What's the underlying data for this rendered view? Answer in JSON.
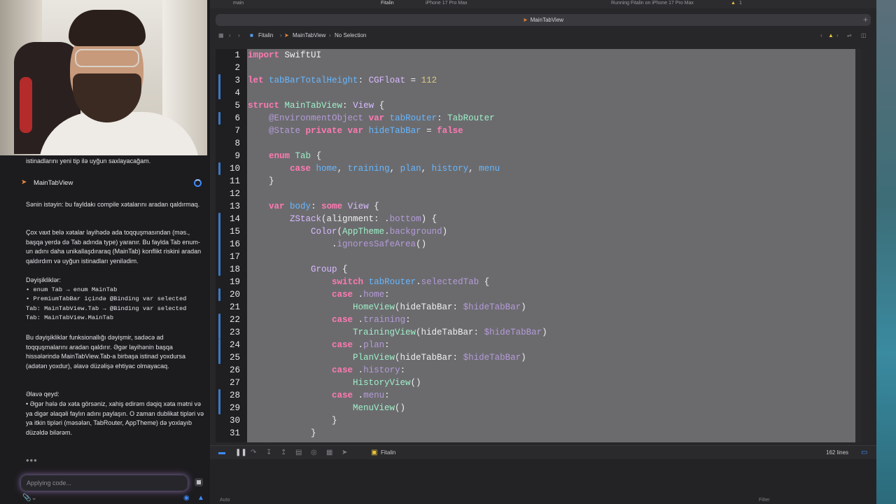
{
  "topbar": {
    "branch": "main",
    "scheme": "Fitalin",
    "device": "iPhone 17 Pro Max",
    "status": "Running Fitalin on iPhone 17 Pro Max",
    "warnings": "1"
  },
  "tab": {
    "file": "MainTabView"
  },
  "jumpbar": {
    "project": "Fitalin",
    "file": "MainTabView",
    "selection": "No Selection"
  },
  "chat": {
    "prev_tail": "istinadlarını yeni tip ilə uyğun saxlayacağam.",
    "file_chip": "MainTabView",
    "para1": "Sənin istəyin: bu fayldakı compile xətalarını aradan qaldırmaq.",
    "para2": "Çox vaxt belə xətalar layihədə ada toqquşmasından (məs., başqa yerdə də Tab adında type) yaranır. Bu faylda Tab enum-un adını daha unikallaşdıraraq (MainTab) konflikt riskini aradan qaldırdım və uyğun istinadları yenilədim.",
    "changes_title": "Dəyişikliklər:",
    "change1": "• enum Tab → enum MainTab",
    "change2": "• PremiumTabBar içində @Binding var selected Tab: MainTabView.Tab → @Binding var selected Tab: MainTabView.MainTab",
    "para3": "Bu dəyişikliklər funksionallığı dəyişmir, sadəcə ad toqquşmalarını aradan qaldırır. Əgər layihənin başqa hissələrində MainTabView.Tab-a birbaşa istinad yoxdursa (adətən yoxdur), əlavə düzəlişə ehtiyac olmayacaq.",
    "extra_title": "Əlavə qeyd:",
    "extra": "• Əgər hələ də xəta görsəniz, xahiş edirəm dəqiq xəta mətni və ya digər əlaqəli faylın adını paylaşın. O zaman dublikat tipləri və ya itkin tipləri (məsələn, TabRouter, AppTheme) də yoxlayıb düzəldə bilərəm.",
    "dots": "•••",
    "input_placeholder": "Applying code..."
  },
  "editor": {
    "line_numbers": [
      "1",
      "2",
      "3",
      "4",
      "5",
      "6",
      "7",
      "8",
      "9",
      "10",
      "11",
      "12",
      "13",
      "14",
      "15",
      "16",
      "17",
      "18",
      "19",
      "20",
      "21",
      "22",
      "23",
      "24",
      "25",
      "26",
      "27",
      "28",
      "29",
      "30",
      "31"
    ],
    "line_count": "162 lines"
  },
  "debugbar": {
    "scheme": "Fitalin"
  },
  "console": {
    "filter_label": "Auto",
    "filter_placeholder": "Filter"
  },
  "colors": {
    "accent": "#3b78c4",
    "keyword": "#ff7ab2",
    "type": "#9ef0c8",
    "number": "#d9c97c"
  }
}
